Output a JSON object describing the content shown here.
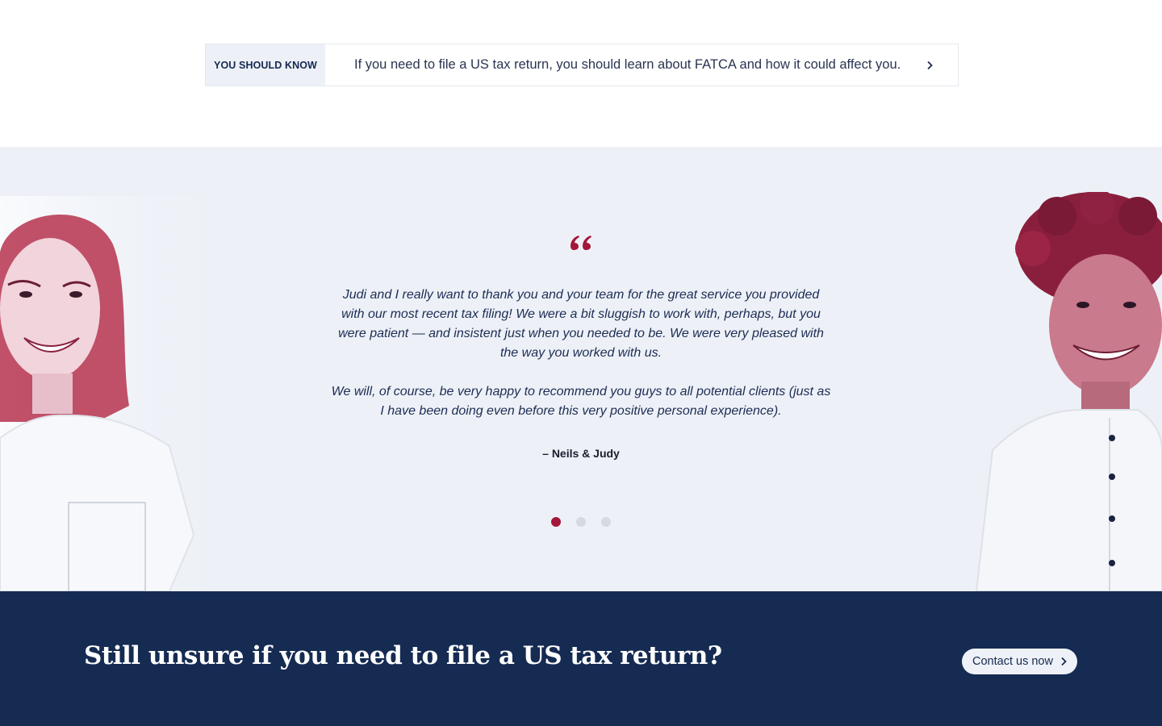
{
  "notice": {
    "tag": "You should know",
    "text": "If you need to file a US tax return, you should learn about FATCA and how it could affect you.",
    "arrow_icon": "chevron-right-icon"
  },
  "testimonial": {
    "quote_icon": "quote-icon",
    "paragraphs": [
      "Judi and I really want to thank you and your team for the great service you provided with our most recent tax filing! We were a bit sluggish to work with, perhaps, but you were patient — and insistent just when you needed to be. We were very pleased with the way you worked with us.",
      "We will, of course, be very happy to recommend you guys to all potential clients (just as I have been doing even before this very positive personal experience)."
    ],
    "author": "– Neils & Judy",
    "slides": 3,
    "active_slide": 1
  },
  "cta": {
    "title": "Still unsure if you need to file a US tax return?",
    "button_label": "Contact us now"
  },
  "colors": {
    "navy": "#152b52",
    "accent_red": "#a3173a",
    "light_bg": "#edf1f7"
  }
}
